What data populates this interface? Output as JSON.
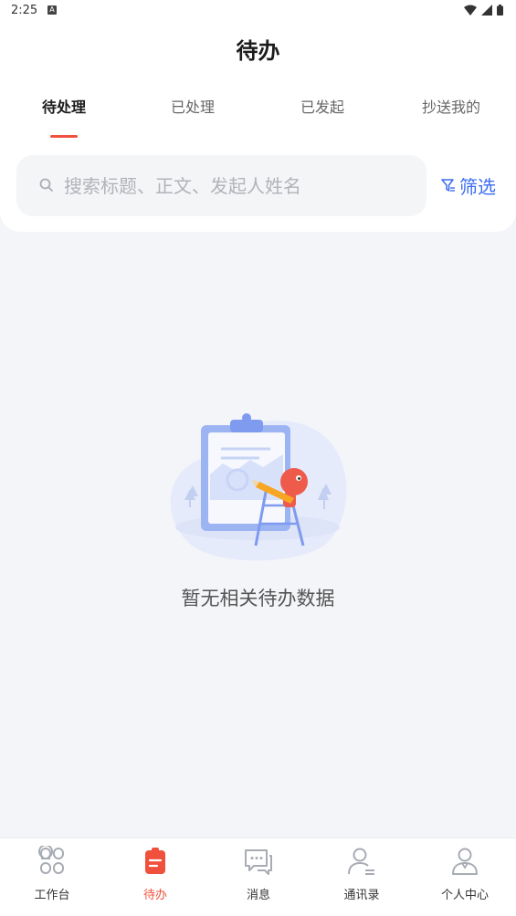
{
  "status_bar": {
    "time": "2:25",
    "notif_glyph": "A"
  },
  "header": {
    "title": "待办"
  },
  "tabs": [
    {
      "label": "待处理",
      "active": true
    },
    {
      "label": "已处理",
      "active": false
    },
    {
      "label": "已发起",
      "active": false
    },
    {
      "label": "抄送我的",
      "active": false
    }
  ],
  "search": {
    "placeholder": "搜索标题、正文、发起人姓名",
    "value": ""
  },
  "filter": {
    "label": "筛选"
  },
  "empty_state": {
    "message": "暂无相关待办数据"
  },
  "bottom_nav": [
    {
      "label": "工作台",
      "icon": "grid-icon",
      "active": false
    },
    {
      "label": "待办",
      "icon": "clipboard-icon",
      "active": true
    },
    {
      "label": "消息",
      "icon": "chat-icon",
      "active": false
    },
    {
      "label": "通讯录",
      "icon": "contacts-icon",
      "active": false
    },
    {
      "label": "个人中心",
      "icon": "user-icon",
      "active": false
    }
  ],
  "colors": {
    "accent": "#f0513d",
    "link": "#3b6cf0",
    "background": "#f4f5f9"
  }
}
